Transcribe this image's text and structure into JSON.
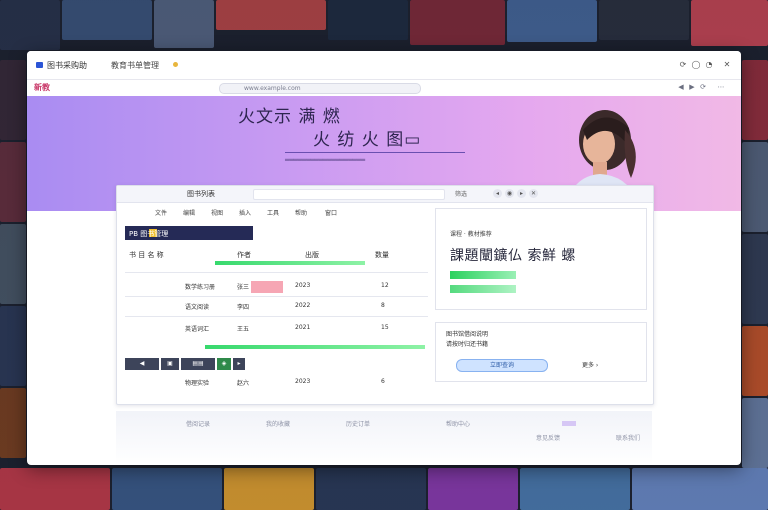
{
  "window": {
    "app_title": "图书采购助",
    "tab_label": "教育书单管理",
    "controls": [
      "⟳",
      "◯",
      "◔",
      "✕"
    ]
  },
  "navbar": {
    "brand": "新教",
    "url": "www.example.com",
    "icons": [
      "◀",
      "▶",
      "⟳",
      "⋯"
    ]
  },
  "hero": {
    "title": "火文示 满 燃",
    "subtitle": "火 纺 火 图▭",
    "tagline": "═══════════════════",
    "accent": "#c79af2"
  },
  "card": {
    "head_title": "图书列表",
    "head_label": "筛选",
    "head_buttons": [
      "◂",
      "◉",
      "▸",
      "✕"
    ],
    "toolbar": [
      "文件",
      "编辑",
      "视图",
      "插入",
      "工具",
      "帮助",
      "窗口"
    ],
    "dark_tab": "PB  图书管理",
    "rows": [
      {
        "name": "书 目 名 称",
        "col2": "作者",
        "col3": "出版",
        "col4": "数量"
      },
      {
        "name": "数学练习册",
        "col2": "张三",
        "col3": "2023",
        "col4": "12"
      },
      {
        "name": "语文阅读",
        "col2": "李四",
        "col3": "2022",
        "col4": "8"
      },
      {
        "name": "英语词汇",
        "col2": "王五",
        "col3": "2021",
        "col4": "15"
      },
      {
        "name": "物理实验",
        "col2": "赵六",
        "col3": "2023",
        "col4": "6"
      }
    ],
    "dark_buttons": [
      "◀",
      "▣",
      "▤▤",
      "◈",
      "▸"
    ]
  },
  "right_panel": {
    "small_label": "课程 · 教材推荐",
    "title": "課題闡鑛仏 索鮮 螺",
    "card2_lines": [
      "图书馆借阅说明",
      "请按时归还书籍"
    ],
    "card2_button": "立即查询",
    "card2_right": "更多 ›"
  },
  "lower": {
    "texts": [
      "借阅记录",
      "我的收藏",
      "历史订单",
      "帮助中心",
      "意见反馈",
      "联系我们"
    ]
  }
}
